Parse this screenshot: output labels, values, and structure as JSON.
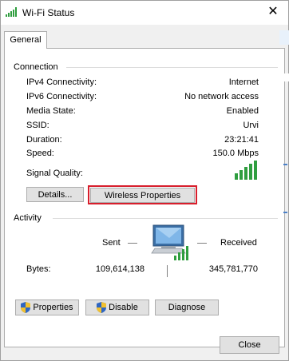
{
  "window": {
    "title": "Wi-Fi Status",
    "close_glyph": "✕"
  },
  "tabs": [
    {
      "label": "General"
    }
  ],
  "connection": {
    "heading": "Connection",
    "rows": [
      {
        "label": "IPv4 Connectivity:",
        "value": "Internet"
      },
      {
        "label": "IPv6 Connectivity:",
        "value": "No network access"
      },
      {
        "label": "Media State:",
        "value": "Enabled"
      },
      {
        "label": "SSID:",
        "value": "Urvi"
      },
      {
        "label": "Duration:",
        "value": "23:21:41"
      },
      {
        "label": "Speed:",
        "value": "150.0 Mbps"
      }
    ],
    "signal_label": "Signal Quality:",
    "signal_bars_filled": 5,
    "signal_bars_total": 5,
    "details_button": "Details...",
    "wireless_properties_button": "Wireless Properties"
  },
  "activity": {
    "heading": "Activity",
    "sent_label": "Sent",
    "received_label": "Received",
    "bytes_label": "Bytes:",
    "bytes_sent": "109,614,138",
    "bytes_received": "345,781,770",
    "properties_button": "Properties",
    "disable_button": "Disable",
    "diagnose_button": "Diagnose"
  },
  "footer": {
    "close_button": "Close"
  },
  "colors": {
    "highlight": "#d81e2c",
    "signal_green": "#2f9e3f",
    "button_bg": "#e1e1e1"
  },
  "icons": [
    "wifi-signal-icon",
    "close-icon",
    "signal-quality-icon",
    "network-computer-icon",
    "shield-icon"
  ]
}
